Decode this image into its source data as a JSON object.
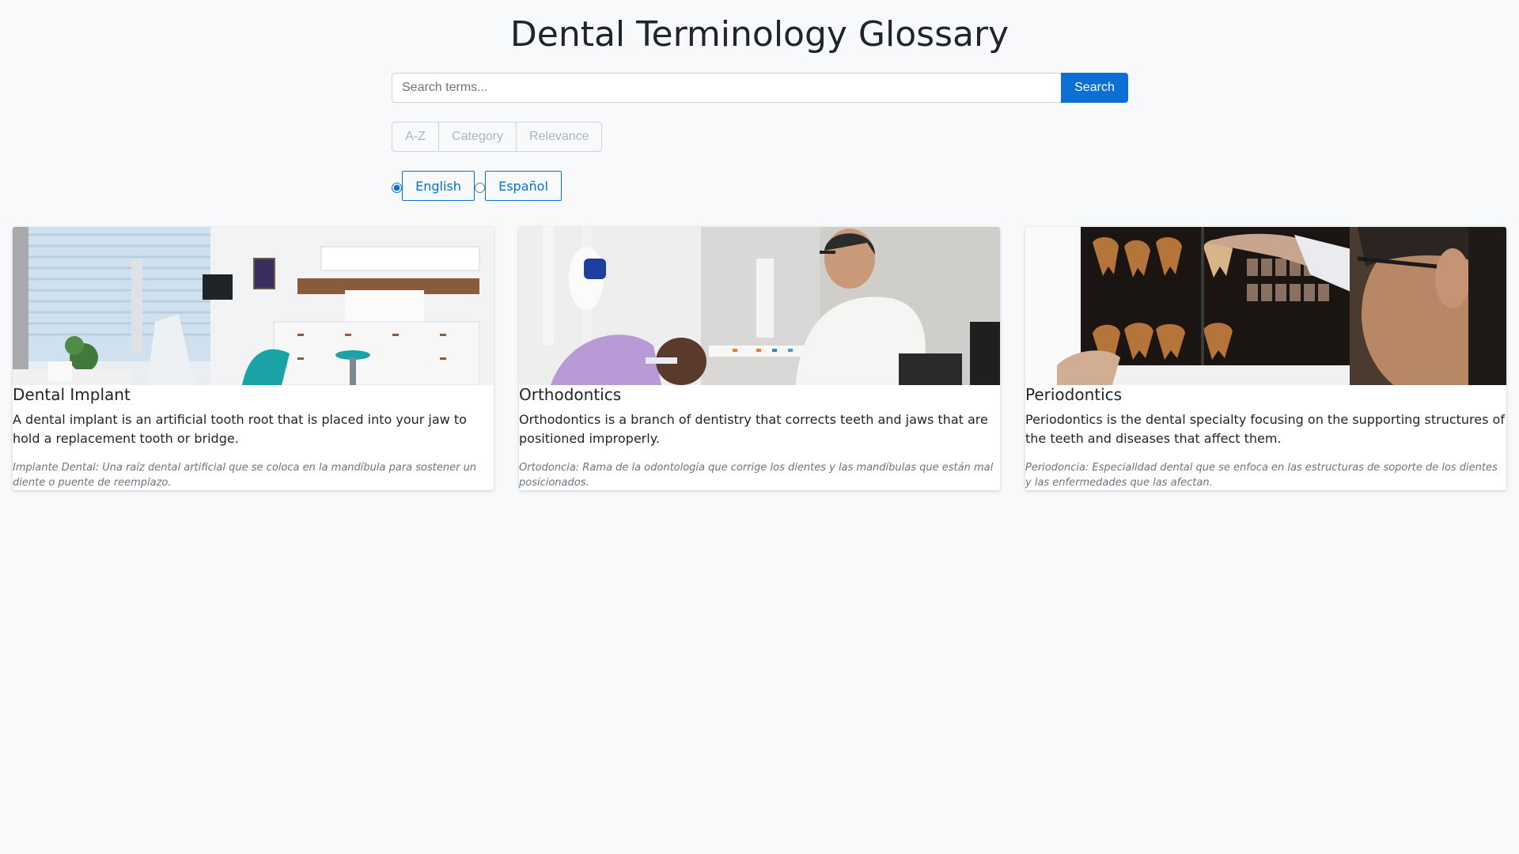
{
  "header": {
    "title": "Dental Terminology Glossary"
  },
  "search": {
    "placeholder": "Search terms...",
    "value": "",
    "button_label": "Search"
  },
  "sort": {
    "options": [
      "A-Z",
      "Category",
      "Relevance"
    ]
  },
  "language": {
    "selected": "English",
    "options": [
      "English",
      "Español"
    ]
  },
  "colors": {
    "accent": "#0b6fd4",
    "background": "#f8f9fa"
  },
  "terms": [
    {
      "title": "Dental Implant",
      "description": "A dental implant is an artificial tooth root that is placed into your jaw to hold a replacement tooth or bridge.",
      "spanish": "Implante Dental: Una raíz dental artificial que se coloca en la mandíbula para sostener un diente o puente de reemplazo.",
      "image": "dental-clinic-room-photo"
    },
    {
      "title": "Orthodontics",
      "description": "Orthodontics is a branch of dentistry that corrects teeth and jaws that are positioned improperly.",
      "spanish": "Ortodoncia: Rama de la odontología que corrige los dientes y las mandíbulas que están mal posicionados.",
      "image": "dentist-with-patient-photo"
    },
    {
      "title": "Periodontics",
      "description": "Periodontics is the dental specialty focusing on the supporting structures of the teeth and diseases that affect them.",
      "spanish": "Periodoncia: Especialidad dental que se enfoca en las estructuras de soporte de los dientes y las enfermedades que las afectan.",
      "image": "dental-xray-review-photo"
    }
  ]
}
